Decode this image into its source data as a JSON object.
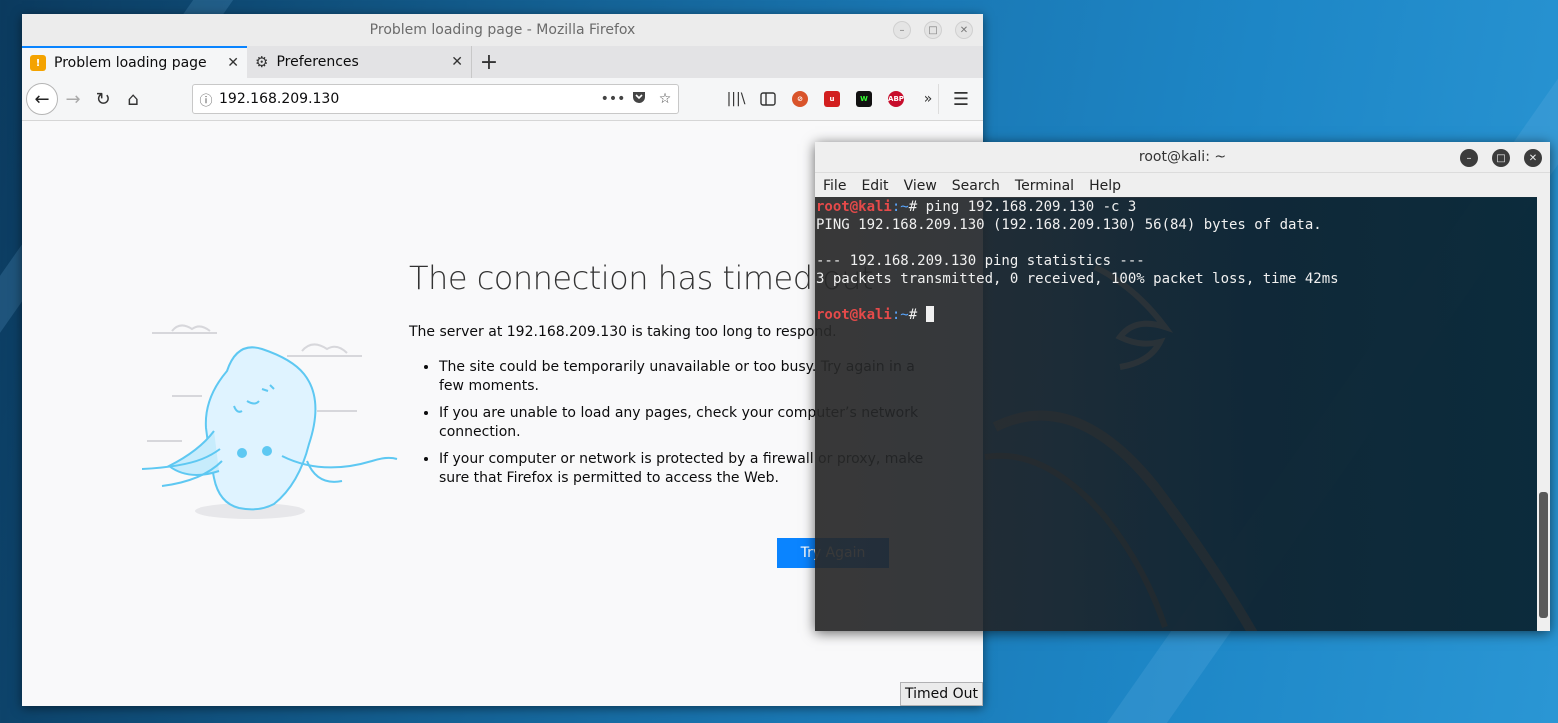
{
  "firefox": {
    "window_title": "Problem loading page - Mozilla Firefox",
    "tabs": [
      {
        "label": "Problem loading page",
        "active": true
      },
      {
        "label": "Preferences",
        "active": false
      }
    ],
    "url": "192.168.209.130",
    "error": {
      "title": "The connection has timed out",
      "description": "The server at 192.168.209.130 is taking too long to respond.",
      "items": [
        "The site could be temporarily unavailable or too busy. Try again in a few moments.",
        "If you are unable to load any pages, check your computer’s network connection.",
        "If your computer or network is protected by a firewall or proxy, make sure that Firefox is permitted to access the Web."
      ],
      "button_label": "Try Again"
    },
    "status_text": "Timed Out"
  },
  "terminal": {
    "window_title": "root@kali: ~",
    "menu": [
      "File",
      "Edit",
      "View",
      "Search",
      "Terminal",
      "Help"
    ],
    "prompt_user": "root@kali",
    "prompt_path": ":~",
    "prompt_symbol": "# ",
    "command": "ping 192.168.209.130 -c 3",
    "output": [
      "PING 192.168.209.130 (192.168.209.130) 56(84) bytes of data.",
      "",
      "--- 192.168.209.130 ping statistics ---",
      "3 packets transmitted, 0 received, 100% packet loss, time 42ms",
      ""
    ]
  },
  "colors": {
    "accent": "#0a84ff",
    "prompt_user": "#e64a4a",
    "prompt_path": "#5aa7ff"
  }
}
